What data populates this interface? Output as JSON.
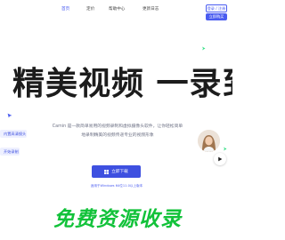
{
  "nav": {
    "items": [
      "首页",
      "定价",
      "帮助中心",
      "更新日志"
    ],
    "active_color": "#4a5cf0"
  },
  "header": {
    "login_label": "登录 / 注册",
    "buy_label": "立即购买"
  },
  "hero": {
    "headline": "精美视频 一录到位",
    "description": "Camin 是一款简单易用的视频录制和虚拟摄像头软件，让你轻松简单地录制精美的视频传递专业的视频形象",
    "download_label": "立即下载",
    "download_note": "适用于Windows 64位11.0以上版本"
  },
  "cards": {
    "camera_label": "内置高清镜头",
    "start_label": "开始录制"
  },
  "icons": {
    "download": "windows-icon",
    "play": "play-icon",
    "cursor": "cursor-icon"
  },
  "watermark": "免费资源收录",
  "colors": {
    "accent": "#4a5cf0",
    "watermark": "#12c23a",
    "headline": "#1c1c1c"
  }
}
